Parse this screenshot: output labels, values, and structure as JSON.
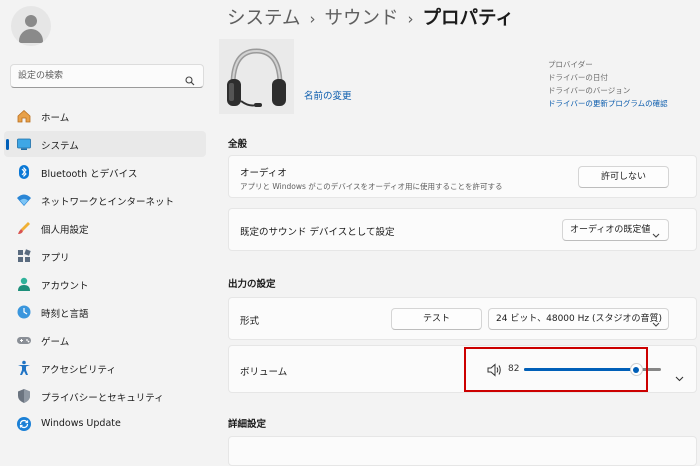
{
  "sidebar": {
    "search_placeholder": "設定の検索",
    "items": [
      {
        "label": "ホーム",
        "icon": "home-icon"
      },
      {
        "label": "システム",
        "icon": "system-icon",
        "selected": true
      },
      {
        "label": "Bluetooth とデバイス",
        "icon": "bluetooth-icon"
      },
      {
        "label": "ネットワークとインターネット",
        "icon": "network-icon"
      },
      {
        "label": "個人用設定",
        "icon": "personalization-icon"
      },
      {
        "label": "アプリ",
        "icon": "apps-icon"
      },
      {
        "label": "アカウント",
        "icon": "account-icon"
      },
      {
        "label": "時刻と言語",
        "icon": "time-language-icon"
      },
      {
        "label": "ゲーム",
        "icon": "gaming-icon"
      },
      {
        "label": "アクセシビリティ",
        "icon": "accessibility-icon"
      },
      {
        "label": "プライバシーとセキュリティ",
        "icon": "privacy-shield-icon"
      },
      {
        "label": "Windows Update",
        "icon": "windows-update-icon"
      }
    ]
  },
  "breadcrumb": {
    "first": "システム",
    "second": "サウンド",
    "current": "プロパティ",
    "separator": "›"
  },
  "device": {
    "icon": "headset-icon",
    "rename_link": "名前の変更",
    "properties": {
      "provider": "プロバイダー",
      "driver_date": "ドライバーの日付",
      "driver_version": "ドライバーのバージョン",
      "driver_update": "ドライバーの更新プログラムの確認"
    }
  },
  "general": {
    "title": "全般",
    "audio": {
      "title": "オーディオ",
      "desc": "アプリと Windows がこのデバイスをオーディオ用に使用することを許可する",
      "button": "許可しない"
    },
    "default_device": {
      "title": "既定のサウンド デバイスとして設定",
      "dropdown": "オーディオの既定値"
    }
  },
  "output": {
    "title": "出力の設定",
    "format": {
      "title": "形式",
      "test_button": "テスト",
      "dropdown": "24 ビット、48000 Hz (スタジオの音質)"
    },
    "volume": {
      "title": "ボリューム",
      "value": "82",
      "level": 82,
      "icon": "speaker-icon",
      "expand_icon": "chevron-down-icon"
    }
  },
  "advanced": {
    "title": "詳細設定"
  },
  "colors": {
    "accent": "#005fb8",
    "highlight": "#cc0000",
    "link": "#0b5cad"
  }
}
